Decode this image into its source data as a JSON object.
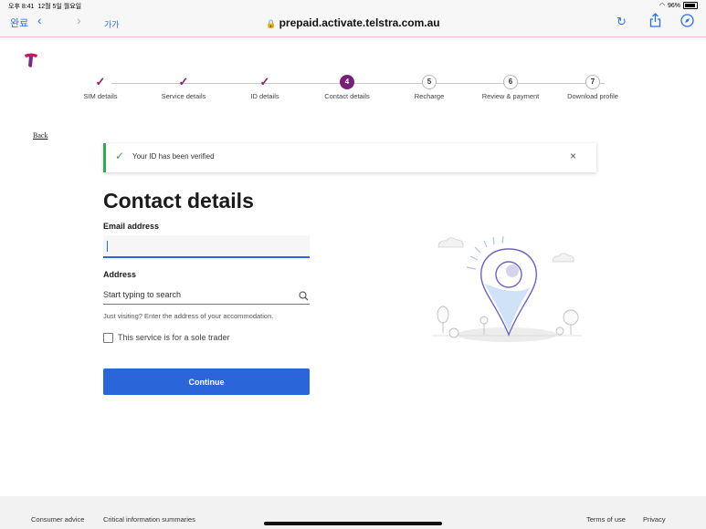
{
  "status_bar": {
    "time": "오후 8:41",
    "date": "12월 5일 월요일",
    "battery": "96%"
  },
  "toolbar": {
    "done_label": "완료",
    "back_icon": "chevron-left-icon",
    "forward_icon": "chevron-right-icon",
    "text_size_label": "가가",
    "url": "prepaid.activate.telstra.com.au"
  },
  "stepper": {
    "steps": [
      {
        "label": "SIM details",
        "marker": "✓",
        "state": "done"
      },
      {
        "label": "Service details",
        "marker": "✓",
        "state": "done"
      },
      {
        "label": "ID details",
        "marker": "✓",
        "state": "done"
      },
      {
        "label": "Contact details",
        "marker": "4",
        "state": "active"
      },
      {
        "label": "Recharge",
        "marker": "5",
        "state": "pending"
      },
      {
        "label": "Review & payment",
        "marker": "6",
        "state": "pending"
      },
      {
        "label": "Download profile",
        "marker": "7",
        "state": "pending"
      }
    ]
  },
  "back_label": "Back",
  "alert": {
    "message": "Your ID has been verified",
    "close": "×"
  },
  "form": {
    "title": "Contact details",
    "email_label": "Email address",
    "email_value": "",
    "address_label": "Address",
    "address_placeholder": "Start typing to search",
    "address_hint": "Just visiting? Enter the address of your accommodation.",
    "sole_trader_label": "This service is for a sole trader",
    "continue_label": "Continue"
  },
  "footer": {
    "consumer_advice": "Consumer advice",
    "critical_info": "Critical information summaries",
    "terms": "Terms of use",
    "privacy": "Privacy"
  },
  "colors": {
    "brand_purple": "#7a1e7a",
    "primary_blue": "#2a66d9",
    "success_green": "#34a853"
  }
}
